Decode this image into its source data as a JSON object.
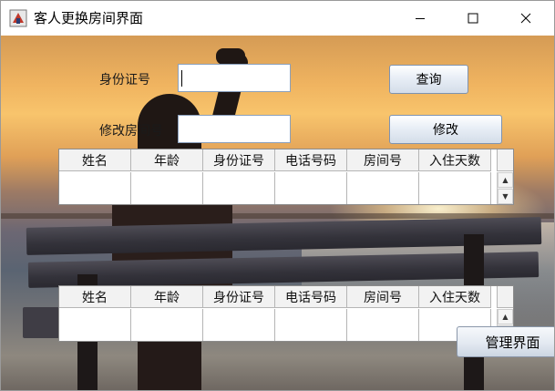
{
  "window": {
    "title": "客人更换房间界面"
  },
  "form": {
    "id_label": "身份证号",
    "id_value": "",
    "query_button": "查询",
    "room_label": "修改房间号",
    "room_value": "",
    "modify_button": "修改"
  },
  "table_top": {
    "columns": [
      "姓名",
      "年龄",
      "身份证号",
      "电话号码",
      "房间号",
      "入住天数"
    ],
    "rows": [
      [
        "",
        "",
        "",
        "",
        "",
        ""
      ],
      [
        "",
        "",
        "",
        "",
        "",
        ""
      ]
    ]
  },
  "table_bottom": {
    "columns": [
      "姓名",
      "年龄",
      "身份证号",
      "电话号码",
      "房间号",
      "入住天数"
    ],
    "rows": [
      [
        "",
        "",
        "",
        "",
        "",
        ""
      ],
      [
        "",
        "",
        "",
        "",
        "",
        ""
      ]
    ]
  },
  "footer": {
    "manage_button": "管理界面"
  },
  "icons": {
    "app": "java-app-icon",
    "minimize": "minimize-icon",
    "maximize": "maximize-icon",
    "close": "close-icon",
    "scroll_up": "arrow-up-icon",
    "scroll_down": "arrow-down-icon"
  },
  "colors": {
    "sky_top": "#f0b460",
    "sea": "#5a6472",
    "button_border": "#7f93b0"
  }
}
